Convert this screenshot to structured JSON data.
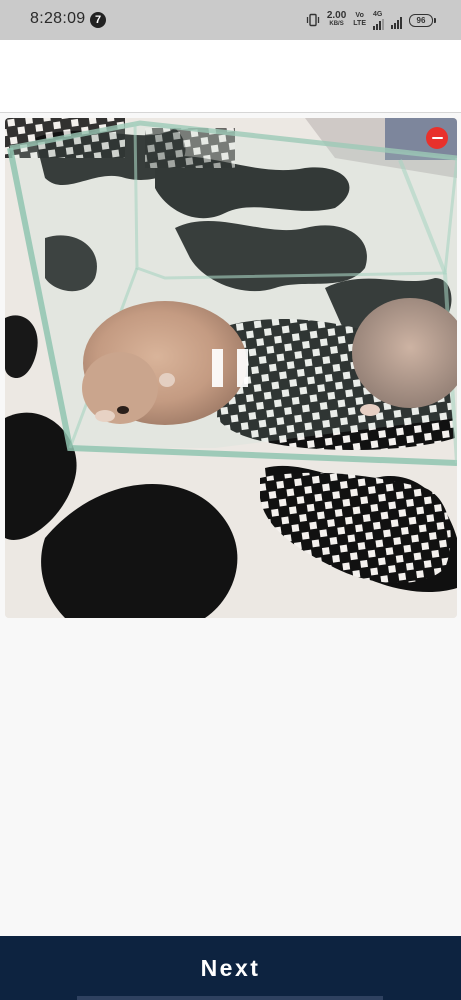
{
  "status_bar": {
    "time": "8:28:09",
    "notification_count": "7",
    "net_speed_value": "2.00",
    "net_speed_unit": "KB/S",
    "volte_top": "Vo",
    "volte_bottom": "LTE",
    "network_type": "4G",
    "battery": "96",
    "icons": [
      "vibrate-icon",
      "signal-icon",
      "signal-icon",
      "battery-icon"
    ]
  },
  "media": {
    "playback_state": "playing",
    "remove_icon": "remove-icon",
    "pause_icon": "pause-icon"
  },
  "footer": {
    "next_label": "Next"
  },
  "colors": {
    "status_bar": "#cacaca",
    "footer": "#0d2340",
    "remove_button": "#e8312c",
    "background": "#f8f8f8"
  }
}
